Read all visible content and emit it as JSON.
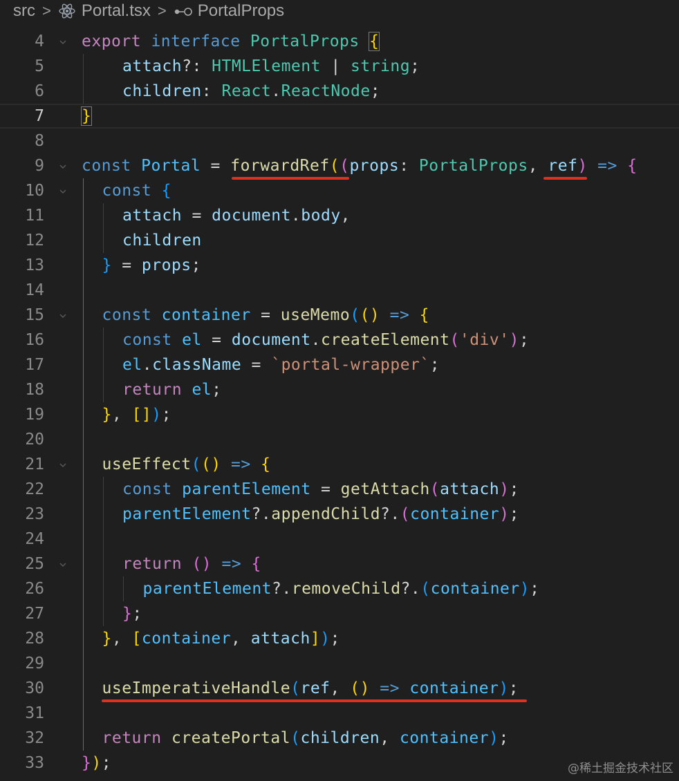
{
  "breadcrumb": {
    "folder": "src",
    "file": "Portal.tsx",
    "symbol": "PortalProps",
    "file_icon": "react-icon",
    "symbol_icon": "interface-icon"
  },
  "editor": {
    "current_line": 7,
    "lines": [
      {
        "n": "4",
        "tokens": [
          [
            "export ",
            "k-ctl"
          ],
          [
            "interface ",
            "k-kw"
          ],
          [
            "PortalProps ",
            "k-type"
          ],
          [
            "{",
            "k-p1 k-bracket-box"
          ]
        ]
      },
      {
        "n": "5",
        "tokens": [
          [
            "attach",
            "k-var"
          ],
          [
            "?: ",
            "k-op"
          ],
          [
            "HTMLElement",
            "k-type"
          ],
          [
            " | ",
            "k-op"
          ],
          [
            "string",
            "k-type"
          ],
          [
            ";",
            "k-op"
          ]
        ]
      },
      {
        "n": "6",
        "tokens": [
          [
            "children",
            "k-var"
          ],
          [
            ": ",
            "k-op"
          ],
          [
            "React",
            "k-type"
          ],
          [
            ".",
            "k-op"
          ],
          [
            "ReactNode",
            "k-type"
          ],
          [
            ";",
            "k-op"
          ]
        ]
      },
      {
        "n": "7",
        "tokens": [
          [
            "}",
            "k-p1 k-bracket-box"
          ]
        ]
      },
      {
        "n": "8",
        "tokens": []
      },
      {
        "n": "9",
        "tokens": [
          [
            "const ",
            "k-kw"
          ],
          [
            "Portal",
            "k-const"
          ],
          [
            " = ",
            "k-op"
          ],
          [
            "forwardRef",
            "k-fn"
          ],
          [
            "(",
            "k-p1"
          ],
          [
            "(",
            "k-p2"
          ],
          [
            "props",
            "k-var"
          ],
          [
            ": ",
            "k-op"
          ],
          [
            "PortalProps",
            "k-type"
          ],
          [
            ", ",
            "k-op"
          ],
          [
            "ref",
            "k-var"
          ],
          [
            ")",
            "k-p2"
          ],
          [
            " => ",
            "k-kw"
          ],
          [
            "{",
            "k-p2"
          ]
        ]
      },
      {
        "n": "10",
        "tokens": [
          [
            "const ",
            "k-kw"
          ],
          [
            "{",
            "k-p3"
          ]
        ]
      },
      {
        "n": "11",
        "tokens": [
          [
            "attach",
            "k-var"
          ],
          [
            " = ",
            "k-op"
          ],
          [
            "document",
            "k-var"
          ],
          [
            ".",
            "k-op"
          ],
          [
            "body",
            "k-var"
          ],
          [
            ",",
            "k-op"
          ]
        ]
      },
      {
        "n": "12",
        "tokens": [
          [
            "children",
            "k-var"
          ]
        ]
      },
      {
        "n": "13",
        "tokens": [
          [
            "}",
            "k-p3"
          ],
          [
            " = ",
            "k-op"
          ],
          [
            "props",
            "k-var"
          ],
          [
            ";",
            "k-op"
          ]
        ]
      },
      {
        "n": "14",
        "tokens": []
      },
      {
        "n": "15",
        "tokens": [
          [
            "const ",
            "k-kw"
          ],
          [
            "container",
            "k-const"
          ],
          [
            " = ",
            "k-op"
          ],
          [
            "useMemo",
            "k-fn"
          ],
          [
            "(",
            "k-p3"
          ],
          [
            "()",
            "k-p1"
          ],
          [
            " => ",
            "k-kw"
          ],
          [
            "{",
            "k-p1"
          ]
        ]
      },
      {
        "n": "16",
        "tokens": [
          [
            "const ",
            "k-kw"
          ],
          [
            "el",
            "k-const"
          ],
          [
            " = ",
            "k-op"
          ],
          [
            "document",
            "k-var"
          ],
          [
            ".",
            "k-op"
          ],
          [
            "createElement",
            "k-fn"
          ],
          [
            "(",
            "k-p2"
          ],
          [
            "'div'",
            "k-str"
          ],
          [
            ")",
            "k-p2"
          ],
          [
            ";",
            "k-op"
          ]
        ]
      },
      {
        "n": "17",
        "tokens": [
          [
            "el",
            "k-const"
          ],
          [
            ".",
            "k-op"
          ],
          [
            "className",
            "k-var"
          ],
          [
            " = ",
            "k-op"
          ],
          [
            "`portal-wrapper`",
            "k-str"
          ],
          [
            ";",
            "k-op"
          ]
        ]
      },
      {
        "n": "18",
        "tokens": [
          [
            "return ",
            "k-ctl"
          ],
          [
            "el",
            "k-const"
          ],
          [
            ";",
            "k-op"
          ]
        ]
      },
      {
        "n": "19",
        "tokens": [
          [
            "}",
            "k-p1"
          ],
          [
            ", ",
            "k-op"
          ],
          [
            "[]",
            "k-p1"
          ],
          [
            ")",
            "k-p3"
          ],
          [
            ";",
            "k-op"
          ]
        ]
      },
      {
        "n": "20",
        "tokens": []
      },
      {
        "n": "21",
        "tokens": [
          [
            "useEffect",
            "k-fn"
          ],
          [
            "(",
            "k-p3"
          ],
          [
            "()",
            "k-p1"
          ],
          [
            " => ",
            "k-kw"
          ],
          [
            "{",
            "k-p1"
          ]
        ]
      },
      {
        "n": "22",
        "tokens": [
          [
            "const ",
            "k-kw"
          ],
          [
            "parentElement",
            "k-const"
          ],
          [
            " = ",
            "k-op"
          ],
          [
            "getAttach",
            "k-fn"
          ],
          [
            "(",
            "k-p2"
          ],
          [
            "attach",
            "k-var"
          ],
          [
            ")",
            "k-p2"
          ],
          [
            ";",
            "k-op"
          ]
        ]
      },
      {
        "n": "23",
        "tokens": [
          [
            "parentElement",
            "k-const"
          ],
          [
            "?.",
            "k-op"
          ],
          [
            "appendChild",
            "k-fn"
          ],
          [
            "?.",
            "k-op"
          ],
          [
            "(",
            "k-p2"
          ],
          [
            "container",
            "k-const"
          ],
          [
            ")",
            "k-p2"
          ],
          [
            ";",
            "k-op"
          ]
        ]
      },
      {
        "n": "24",
        "tokens": []
      },
      {
        "n": "25",
        "tokens": [
          [
            "return ",
            "k-ctl"
          ],
          [
            "()",
            "k-p2"
          ],
          [
            " => ",
            "k-kw"
          ],
          [
            "{",
            "k-p2"
          ]
        ]
      },
      {
        "n": "26",
        "tokens": [
          [
            "parentElement",
            "k-const"
          ],
          [
            "?.",
            "k-op"
          ],
          [
            "removeChild",
            "k-fn"
          ],
          [
            "?.",
            "k-op"
          ],
          [
            "(",
            "k-p3"
          ],
          [
            "container",
            "k-const"
          ],
          [
            ")",
            "k-p3"
          ],
          [
            ";",
            "k-op"
          ]
        ]
      },
      {
        "n": "27",
        "tokens": [
          [
            "}",
            "k-p2"
          ],
          [
            ";",
            "k-op"
          ]
        ]
      },
      {
        "n": "28",
        "tokens": [
          [
            "}",
            "k-p1"
          ],
          [
            ", ",
            "k-op"
          ],
          [
            "[",
            "k-p1"
          ],
          [
            "container",
            "k-const"
          ],
          [
            ", ",
            "k-op"
          ],
          [
            "attach",
            "k-var"
          ],
          [
            "]",
            "k-p1"
          ],
          [
            ")",
            "k-p3"
          ],
          [
            ";",
            "k-op"
          ]
        ]
      },
      {
        "n": "29",
        "tokens": []
      },
      {
        "n": "30",
        "tokens": [
          [
            "useImperativeHandle",
            "k-fn"
          ],
          [
            "(",
            "k-p3"
          ],
          [
            "ref",
            "k-var"
          ],
          [
            ", ",
            "k-op"
          ],
          [
            "()",
            "k-p1"
          ],
          [
            " => ",
            "k-kw"
          ],
          [
            "container",
            "k-const"
          ],
          [
            ")",
            "k-p3"
          ],
          [
            ";",
            "k-op"
          ]
        ]
      },
      {
        "n": "31",
        "tokens": []
      },
      {
        "n": "32",
        "tokens": [
          [
            "return ",
            "k-ctl"
          ],
          [
            "createPortal",
            "k-fn"
          ],
          [
            "(",
            "k-p3"
          ],
          [
            "children",
            "k-var"
          ],
          [
            ", ",
            "k-op"
          ],
          [
            "container",
            "k-const"
          ],
          [
            ")",
            "k-p3"
          ],
          [
            ";",
            "k-op"
          ]
        ]
      },
      {
        "n": "33",
        "tokens": [
          [
            "}",
            "k-p2"
          ],
          [
            ")",
            "k-p1"
          ],
          [
            ";",
            "k-op"
          ]
        ]
      }
    ]
  },
  "annotations": {
    "underline_color": "#e0301e",
    "underlined_tokens": [
      "forwardRef(",
      "ref",
      "useImperativeHandle(ref, () => container);"
    ]
  },
  "watermark": "@稀土掘金技术社区"
}
